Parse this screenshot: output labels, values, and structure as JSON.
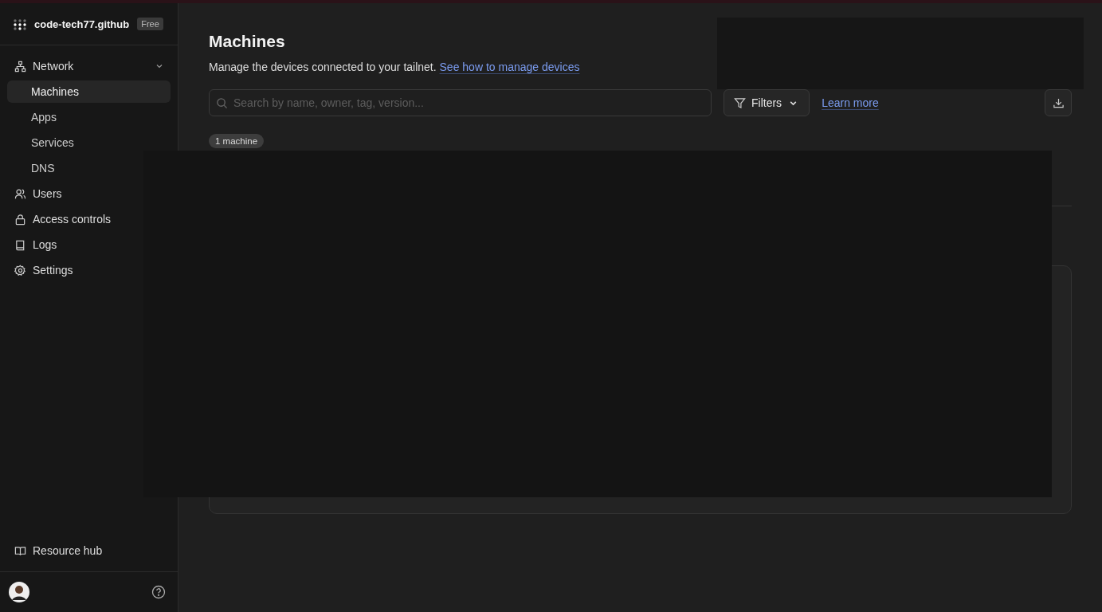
{
  "sidebar": {
    "org": "code-tech77.github",
    "plan": "Free",
    "nav": [
      {
        "label": "Network",
        "kind": "network",
        "expanded": true,
        "children": [
          {
            "label": "Machines",
            "selected": true
          },
          {
            "label": "Apps",
            "selected": false
          },
          {
            "label": "Services",
            "selected": false
          },
          {
            "label": "DNS",
            "selected": false
          }
        ]
      },
      {
        "label": "Users",
        "kind": "users"
      },
      {
        "label": "Access controls",
        "kind": "lock"
      },
      {
        "label": "Logs",
        "kind": "book"
      },
      {
        "label": "Settings",
        "kind": "gear"
      }
    ],
    "footer_link": "Resource hub"
  },
  "page": {
    "title": "Machines",
    "description": "Manage the devices connected to your tailnet.",
    "link": "See how to manage devices",
    "search": {
      "placeholder": "Search by name, owner, tag, version..."
    },
    "filters_button": "Filters",
    "learn_more": "Learn more",
    "count_badge": "1 machine"
  }
}
